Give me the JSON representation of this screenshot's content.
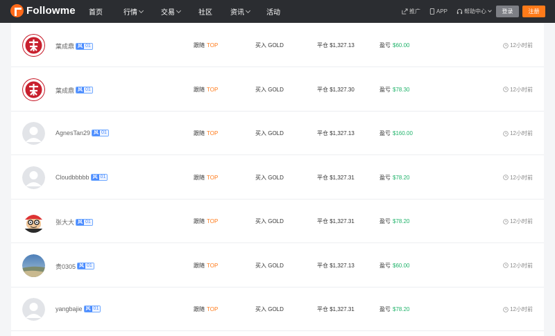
{
  "header": {
    "brand": "Followme",
    "nav": [
      {
        "label": "首页",
        "dropdown": false
      },
      {
        "label": "行情",
        "dropdown": true
      },
      {
        "label": "交易",
        "dropdown": true
      },
      {
        "label": "社区",
        "dropdown": false
      },
      {
        "label": "资讯",
        "dropdown": true
      },
      {
        "label": "活动",
        "dropdown": false
      }
    ],
    "links": {
      "promote": "推广",
      "app": "APP",
      "help": "帮助中心"
    },
    "login_label": "登录",
    "register_label": "注册"
  },
  "labels": {
    "follow": "跟随",
    "follow_tag": "TOP",
    "profit": "盈亏"
  },
  "avatar_colors": {
    "red_logo": "#c8202e",
    "default_gray": "#e2e4e8",
    "accent_orange": "#ff7b1a",
    "profit_green": "#1fb36a"
  },
  "trades": [
    {
      "user": "葉成鼎",
      "avatar": "red-logo",
      "badge_icon": "风",
      "badge_num": "01",
      "action": "买入 GOLD",
      "close": "平仓 $1,327.13",
      "profit": "$60.00",
      "time": "12小时前"
    },
    {
      "user": "葉成鼎",
      "avatar": "red-logo",
      "badge_icon": "风",
      "badge_num": "01",
      "action": "买入 GOLD",
      "close": "平仓 $1,327.30",
      "profit": "$78.30",
      "time": "12小时前"
    },
    {
      "user": "AgnesTan29",
      "avatar": "default",
      "badge_icon": "风",
      "badge_num": "01",
      "action": "买入 GOLD",
      "close": "平仓 $1,327.13",
      "profit": "$160.00",
      "time": "12小时前"
    },
    {
      "user": "Cloudbbbbb",
      "avatar": "default",
      "badge_icon": "风",
      "badge_num": "01",
      "action": "买入 GOLD",
      "close": "平仓 $1,327.31",
      "profit": "$78.20",
      "time": "12小时前"
    },
    {
      "user": "张大大",
      "avatar": "cartoon",
      "badge_icon": "风",
      "badge_num": "01",
      "action": "买入 GOLD",
      "close": "平仓 $1,327.31",
      "profit": "$78.20",
      "time": "12小时前"
    },
    {
      "user": "贵0305",
      "avatar": "landscape",
      "badge_icon": "风",
      "badge_num": "01",
      "action": "买入 GOLD",
      "close": "平仓 $1,327.13",
      "profit": "$60.00",
      "time": "12小时前"
    },
    {
      "user": "yangbajie",
      "avatar": "default",
      "badge_icon": "风",
      "badge_num": "01",
      "action": "买入 GOLD",
      "close": "平仓 $1,327.31",
      "profit": "$78.20",
      "time": "12小时前"
    }
  ]
}
